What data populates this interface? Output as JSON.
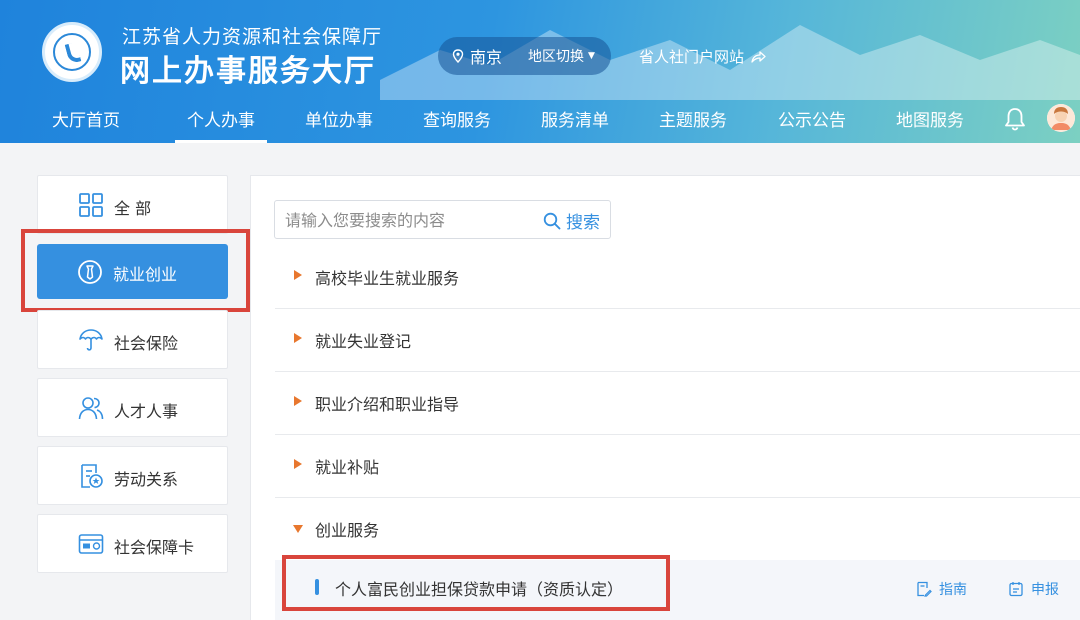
{
  "header": {
    "org_name": "江苏省人力资源和社会保障厅",
    "hall_name": "网上办事服务大厅",
    "city": "南京",
    "region_switch": "地区切换",
    "portal_link": "省人社门户网站"
  },
  "nav": {
    "items": [
      {
        "label": "大厅首页"
      },
      {
        "label": "个人办事",
        "active": true
      },
      {
        "label": "单位办事"
      },
      {
        "label": "查询服务"
      },
      {
        "label": "服务清单"
      },
      {
        "label": "主题服务"
      },
      {
        "label": "公示公告"
      },
      {
        "label": "地图服务"
      }
    ]
  },
  "sidebar": {
    "items": [
      {
        "label": "全 部",
        "icon": "grid-icon"
      },
      {
        "label": "就业创业",
        "icon": "briefcase-icon",
        "active": true
      },
      {
        "label": "社会保险",
        "icon": "umbrella-icon"
      },
      {
        "label": "人才人事",
        "icon": "people-icon"
      },
      {
        "label": "劳动关系",
        "icon": "contract-icon"
      },
      {
        "label": "社会保障卡",
        "icon": "card-icon"
      }
    ]
  },
  "search": {
    "placeholder": "请输入您要搜索的内容",
    "button": "搜索"
  },
  "categories": [
    {
      "label": "高校毕业生就业服务",
      "expanded": false
    },
    {
      "label": "就业失业登记",
      "expanded": false
    },
    {
      "label": "职业介绍和职业指导",
      "expanded": false
    },
    {
      "label": "就业补贴",
      "expanded": false
    },
    {
      "label": "创业服务",
      "expanded": true
    }
  ],
  "sub_item": {
    "label": "个人富民创业担保贷款申请（资质认定）",
    "guide": "指南",
    "apply": "申报"
  },
  "colors": {
    "accent": "#3590e0",
    "highlight_box": "#d9453c",
    "arrow": "#e8772e"
  }
}
